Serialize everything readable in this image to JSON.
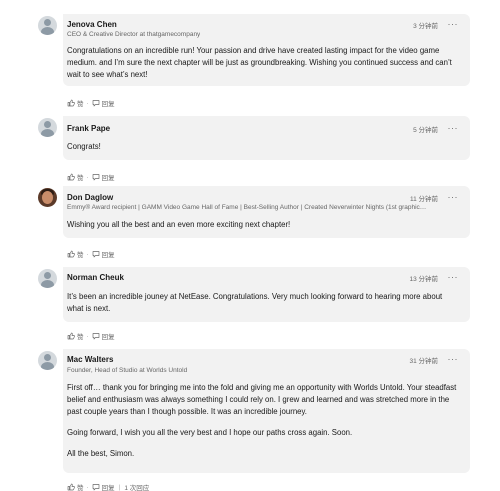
{
  "comments": [
    {
      "name": "Jenova Chen",
      "headline": "CEO & Creative Director at thatgamecompany",
      "time": "3 分钟前",
      "more": "···",
      "paragraphs": [
        "Congratulations on an incredible run! Your passion and drive have created lasting impact for the video game medium. and I’m sure the next chapter will be just as groundbreaking. Wishing you continued success and can’t wait to see what’s next!"
      ],
      "like_label": "赞",
      "dot": "·",
      "reply_label": "回复"
    },
    {
      "name": "Frank Pape",
      "headline": "",
      "time": "5 分钟前",
      "more": "···",
      "paragraphs": [
        "Congrats!"
      ],
      "like_label": "赞",
      "dot": "·",
      "reply_label": "回复"
    },
    {
      "name": "Don Daglow",
      "headline": "Emmy® Award recipient | GAMM Video Game Hall of Fame | Best-Selling Author | Created Neverwinter Nights (1st graphic…",
      "time": "11 分钟前",
      "more": "···",
      "paragraphs": [
        "Wishing you all the best and an even more exciting next chapter!"
      ],
      "like_label": "赞",
      "dot": "·",
      "reply_label": "回复"
    },
    {
      "name": "Norman Cheuk",
      "headline": "",
      "time": "13 分钟前",
      "more": "···",
      "paragraphs": [
        "It’s been an incredible jouney at NetEase.  Congratulations.  Very much looking forward to hearing more about what is next."
      ],
      "like_label": "赞",
      "dot": "·",
      "reply_label": "回复"
    },
    {
      "name": "Mac Walters",
      "headline": "Founder, Head of Studio at Worlds Untold",
      "time": "31 分钟前",
      "more": "···",
      "paragraphs": [
        "First off… thank you for bringing me into the fold and giving me an opportunity with Worlds Untold. Your steadfast belief and enthusiasm was always something I could rely on. I grew and learned and was stretched more in the past couple years than I though possible. It was an incredible journey.",
        "Going forward, I wish you all the very best and I hope our paths cross again. Soon.",
        "All the best, Simon."
      ],
      "like_label": "赞",
      "dot": "·",
      "reply_label": "回复",
      "reply_count": "1 次回应"
    }
  ],
  "icons": {
    "avatar": "person-silhouette",
    "like": "thumbs-up-icon",
    "reply": "reply-icon",
    "more": "more-icon"
  },
  "colors": {
    "bubble": "#f2f2f2",
    "muted": "#666666",
    "text": "#191919"
  }
}
